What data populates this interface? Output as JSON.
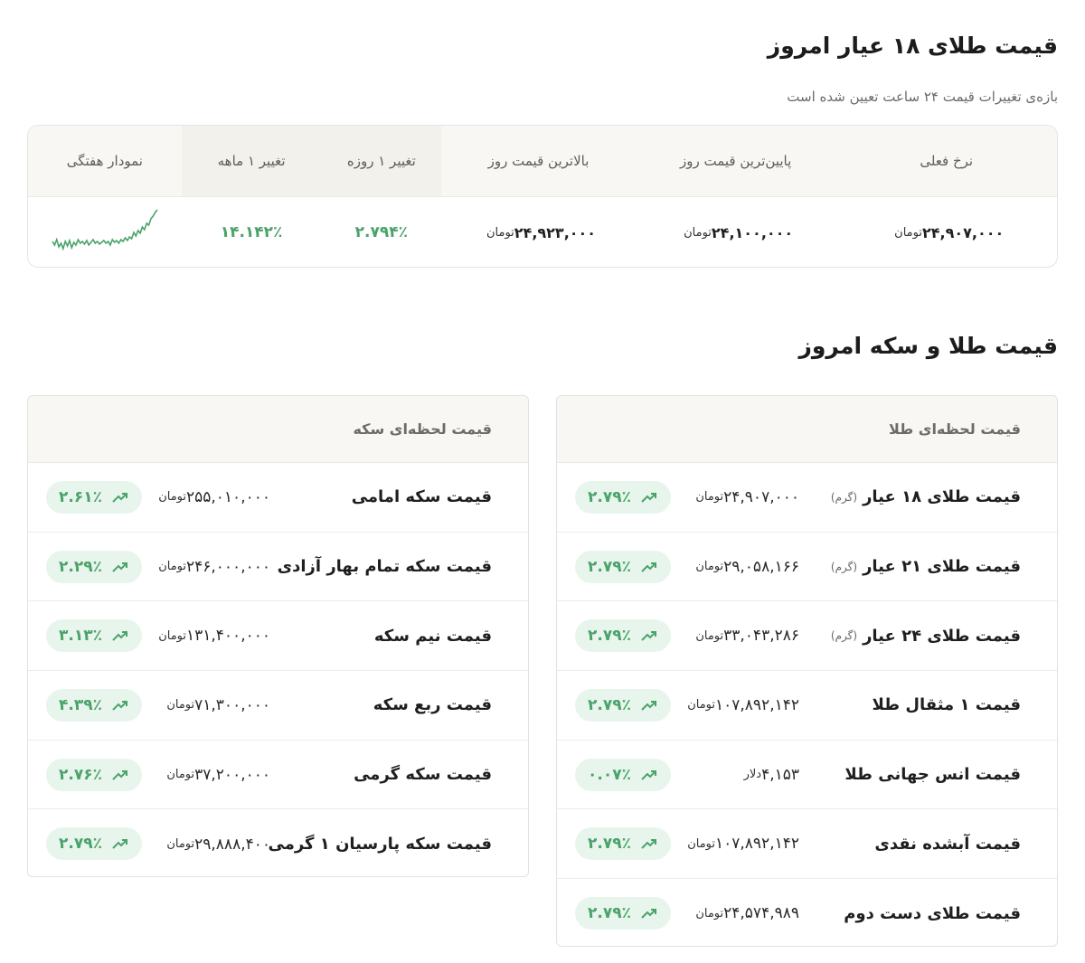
{
  "page": {
    "title_18k": "قیمت طلای ۱۸ عیار امروز",
    "subtitle_18k": "بازه‌ی تغییرات قیمت ۲۴ ساعت تعیین شده است",
    "title_gold_coin": "قیمت طلا و سکه امروز"
  },
  "summary": {
    "headers": {
      "current": "نرخ فعلی",
      "low": "پایین‌ترین قیمت روز",
      "high": "بالاترین قیمت روز",
      "change_1d": "تغییر ۱ روزه",
      "change_1m": "تغییر ۱ ماهه",
      "weekly_chart": "نمودار هفتگی"
    },
    "unit": "تومان",
    "current": "۲۴,۹۰۷,۰۰۰",
    "low": "۲۴,۱۰۰,۰۰۰",
    "high": "۲۴,۹۲۳,۰۰۰",
    "change_1d": "۲.۷۹۴٪",
    "change_1m": "۱۴.۱۴۲٪",
    "sparkline_color": "#4aa36a"
  },
  "gold_card": {
    "title": "قیمت لحظه‌ای طلا",
    "rows": [
      {
        "name": "قیمت طلای ۱۸ عیار",
        "note": "(گرم)",
        "price": "۲۴,۹۰۷,۰۰۰",
        "unit": "تومان",
        "change": "۲.۷۹٪"
      },
      {
        "name": "قیمت طلای ۲۱ عیار",
        "note": "(گرم)",
        "price": "۲۹,۰۵۸,۱۶۶",
        "unit": "تومان",
        "change": "۲.۷۹٪"
      },
      {
        "name": "قیمت طلای ۲۴ عیار",
        "note": "(گرم)",
        "price": "۳۳,۰۴۳,۲۸۶",
        "unit": "تومان",
        "change": "۲.۷۹٪"
      },
      {
        "name": "قیمت ۱ مثقال طلا",
        "note": "",
        "price": "۱۰۷,۸۹۲,۱۴۲",
        "unit": "تومان",
        "change": "۲.۷۹٪"
      },
      {
        "name": "قیمت انس جهانی طلا",
        "note": "",
        "price": "۴,۱۵۳",
        "unit": "دلار",
        "change": "۰.۰۷٪"
      },
      {
        "name": "قیمت آبشده نقدی",
        "note": "",
        "price": "۱۰۷,۸۹۲,۱۴۲",
        "unit": "تومان",
        "change": "۲.۷۹٪"
      },
      {
        "name": "قیمت طلای دست دوم",
        "note": "",
        "price": "۲۴,۵۷۴,۹۸۹",
        "unit": "تومان",
        "change": "۲.۷۹٪"
      }
    ]
  },
  "coin_card": {
    "title": "قیمت لحظه‌ای سکه",
    "rows": [
      {
        "name": "قیمت سکه امامی",
        "price": "۲۵۵,۰۱۰,۰۰۰",
        "unit": "تومان",
        "change": "۲.۶۱٪"
      },
      {
        "name": "قیمت سکه تمام بهار آزادی",
        "price": "۲۴۶,۰۰۰,۰۰۰",
        "unit": "تومان",
        "change": "۲.۲۹٪"
      },
      {
        "name": "قیمت نیم سکه",
        "price": "۱۳۱,۴۰۰,۰۰۰",
        "unit": "تومان",
        "change": "۳.۱۳٪"
      },
      {
        "name": "قیمت ربع سکه",
        "price": "۷۱,۳۰۰,۰۰۰",
        "unit": "تومان",
        "change": "۴.۳۹٪"
      },
      {
        "name": "قیمت سکه گرمی",
        "price": "۳۷,۲۰۰,۰۰۰",
        "unit": "تومان",
        "change": "۲.۷۶٪"
      },
      {
        "name": "قیمت سکه پارسیان ۱ گرمی",
        "price": "۲۹,۸۸۸,۴۰۰",
        "unit": "تومان",
        "change": "۲.۷۹٪"
      }
    ]
  },
  "colors": {
    "positive": "#4aa36a",
    "badge_bg": "#e8f5ec",
    "header_bg": "#f8f7f3"
  }
}
